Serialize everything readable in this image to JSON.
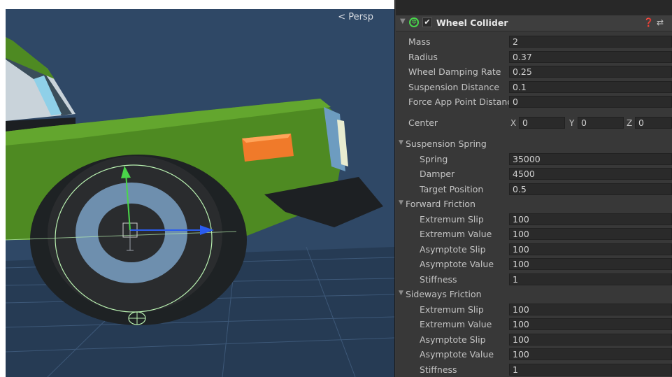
{
  "scene": {
    "view_mode": "Persp"
  },
  "inspector": {
    "component_title": "Wheel Collider",
    "enabled": true,
    "fields": [
      {
        "label": "Mass",
        "value": "2"
      },
      {
        "label": "Radius",
        "value": "0.37"
      },
      {
        "label": "Wheel Damping Rate",
        "value": "0.25"
      },
      {
        "label": "Suspension Distance",
        "value": "0.1"
      },
      {
        "label": "Force App Point Distanc",
        "value": "0"
      }
    ],
    "center": {
      "label": "Center",
      "x_label": "X",
      "x": "0",
      "y_label": "Y",
      "y": "0",
      "z_label": "Z",
      "z": "0"
    },
    "suspension_spring": {
      "label": "Suspension Spring",
      "fields": [
        {
          "label": "Spring",
          "value": "35000"
        },
        {
          "label": "Damper",
          "value": "4500"
        },
        {
          "label": "Target Position",
          "value": "0.5"
        }
      ]
    },
    "forward_friction": {
      "label": "Forward Friction",
      "fields": [
        {
          "label": "Extremum Slip",
          "value": "100"
        },
        {
          "label": "Extremum Value",
          "value": "100"
        },
        {
          "label": "Asymptote Slip",
          "value": "100"
        },
        {
          "label": "Asymptote Value",
          "value": "100"
        },
        {
          "label": "Stiffness",
          "value": "1"
        }
      ]
    },
    "sideways_friction": {
      "label": "Sideways Friction",
      "fields": [
        {
          "label": "Extremum Slip",
          "value": "100"
        },
        {
          "label": "Extremum Value",
          "value": "100"
        },
        {
          "label": "Asymptote Slip",
          "value": "100"
        },
        {
          "label": "Asymptote Value",
          "value": "100"
        },
        {
          "label": "Stiffness",
          "value": "1"
        }
      ]
    }
  },
  "colors": {
    "car_body": "#4e8a22",
    "tire": "#262829",
    "rim": "#6e8fae",
    "indicator": "#f07a2a",
    "gizmo_y": "#4ad64a",
    "gizmo_x": "#2a5cf0",
    "collider_outline": "#b8f0b0",
    "inspector_bg": "#383838"
  }
}
